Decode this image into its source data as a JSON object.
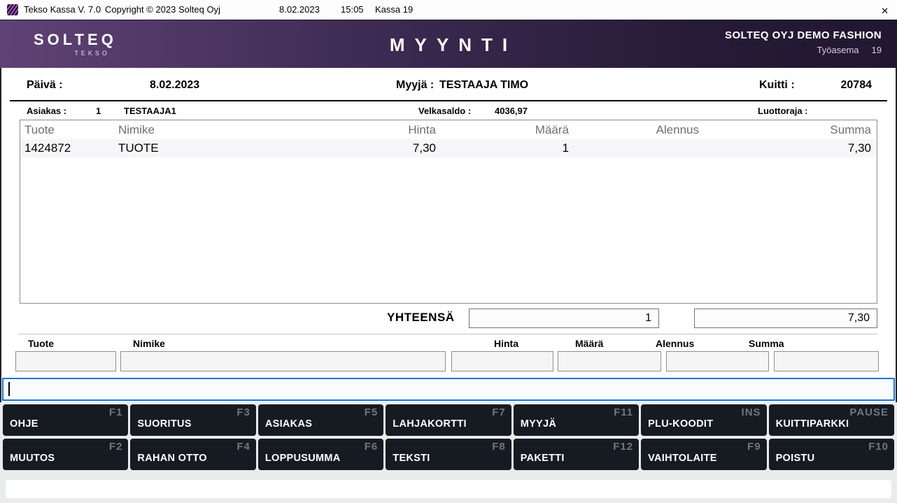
{
  "titlebar": {
    "icon": "tekso-app-icon",
    "title": "Tekso Kassa V. 7.0",
    "copyright": "Copyright © 2023 Solteq Oyj",
    "date": "8.02.2023",
    "time": "15:05",
    "register": "Kassa 19",
    "close_glyph": "✕"
  },
  "header": {
    "logo_main": "SOLTEQ",
    "logo_sub": "TEKSO",
    "title": "MYYNTI",
    "store_name": "SOLTEQ OYJ DEMO FASHION",
    "workstation_label": "Työasema",
    "workstation_number": "19"
  },
  "sale_header": {
    "date_label": "Päivä :",
    "date_value": "8.02.2023",
    "seller_label": "Myyjä :",
    "seller_value": "TESTAAJA TIMO",
    "receipt_label": "Kuitti :",
    "receipt_value": "20784"
  },
  "customer_row": {
    "customer_label": "Asiakas :",
    "customer_number": "1",
    "customer_name": "TESTAAJA1",
    "debt_label": "Velkasaldo :",
    "debt_value": "4036,97",
    "credit_label": "Luottoraja :",
    "credit_value": ""
  },
  "items_table": {
    "columns": [
      "Tuote",
      "Nimike",
      "Hinta",
      "Määrä",
      "Alennus",
      "Summa"
    ],
    "rows": [
      {
        "tuote": "1424872",
        "nimike": "TUOTE",
        "hinta": "7,30",
        "maara": "1",
        "alennus": "",
        "summa": "7,30"
      }
    ]
  },
  "totals": {
    "label": "YHTEENSÄ",
    "total_quantity": "1",
    "total_sum": "7,30"
  },
  "entry": {
    "labels": [
      "Tuote",
      "Nimike",
      "Hinta",
      "Määrä",
      "Alennus",
      "Summa"
    ],
    "values": [
      "",
      "",
      "",
      "",
      "",
      ""
    ],
    "command_value": ""
  },
  "function_keys": {
    "row1": [
      {
        "label": "OHJE",
        "key": "F1"
      },
      {
        "label": "SUORITUS",
        "key": "F3"
      },
      {
        "label": "ASIAKAS",
        "key": "F5"
      },
      {
        "label": "LAHJAKORTTI",
        "key": "F7"
      },
      {
        "label": "MYYJÄ",
        "key": "F11"
      },
      {
        "label": "PLU-KOODIT",
        "key": "INS"
      },
      {
        "label": "KUITTIPARKKI",
        "key": "PAUSE"
      }
    ],
    "row2": [
      {
        "label": "MUUTOS",
        "key": "F2"
      },
      {
        "label": "RAHAN OTTO",
        "key": "F4"
      },
      {
        "label": "LOPPUSUMMA",
        "key": "F6"
      },
      {
        "label": "TEKSTI",
        "key": "F8"
      },
      {
        "label": "PAKETTI",
        "key": "F12"
      },
      {
        "label": "VAIHTOLAITE",
        "key": "F9"
      },
      {
        "label": "POISTU",
        "key": "F10"
      }
    ]
  },
  "colors": {
    "header_gradient_start": "#5f4276",
    "header_gradient_end": "#221731",
    "button_background": "#161b22",
    "button_key_text": "#6e7684",
    "focused_input_border": "#1478ce"
  }
}
